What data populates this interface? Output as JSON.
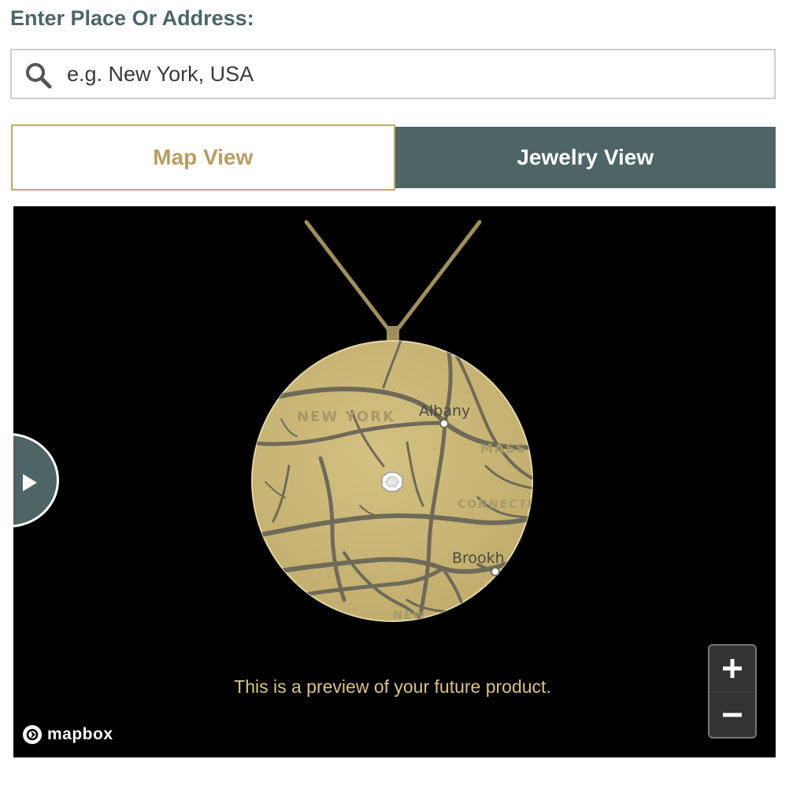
{
  "search": {
    "label": "Enter Place Or Address:",
    "placeholder": "e.g. New York, USA",
    "value": ""
  },
  "tabs": [
    {
      "label": "Map View",
      "active": false
    },
    {
      "label": "Jewelry View",
      "active": true
    }
  ],
  "map_labels": {
    "region_ny": "NEW YORK",
    "city_albany": "Albany",
    "region_mass": "MASS",
    "region_conn": "CONNECTI",
    "city_brook": "Brookh",
    "region_new": "NEW"
  },
  "caption": "This is a preview of your future product.",
  "attribution": "mapbox",
  "icons": {
    "search": "search-icon",
    "toggle": "play-icon",
    "zoom_in": "plus-icon",
    "zoom_out": "minus-icon",
    "logo": "mapbox-logo-icon"
  },
  "colors": {
    "accent_teal": "#4e6466",
    "gold": "#b99d60",
    "pendant_gold": "#c9b678",
    "caption": "#d8c486"
  }
}
